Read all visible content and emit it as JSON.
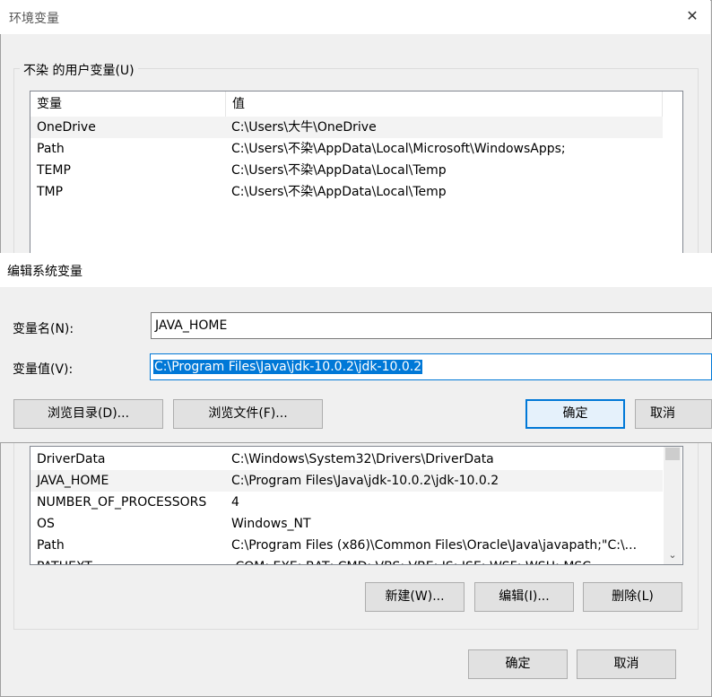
{
  "env": {
    "title": "环境变量",
    "close_glyph": "✕",
    "user_group_label": "不染 的用户变量(U)",
    "columns": {
      "var": "变量",
      "val": "值"
    },
    "user_vars": [
      {
        "name": "OneDrive",
        "value": "C:\\Users\\大牛\\OneDrive"
      },
      {
        "name": "Path",
        "value": "C:\\Users\\不染\\AppData\\Local\\Microsoft\\WindowsApps;"
      },
      {
        "name": "TEMP",
        "value": "C:\\Users\\不染\\AppData\\Local\\Temp"
      },
      {
        "name": "TMP",
        "value": "C:\\Users\\不染\\AppData\\Local\\Temp"
      }
    ],
    "system_vars": [
      {
        "name": "DriverData",
        "value": "C:\\Windows\\System32\\Drivers\\DriverData"
      },
      {
        "name": "JAVA_HOME",
        "value": "C:\\Program Files\\Java\\jdk-10.0.2\\jdk-10.0.2"
      },
      {
        "name": "NUMBER_OF_PROCESSORS",
        "value": "4"
      },
      {
        "name": "OS",
        "value": "Windows_NT"
      },
      {
        "name": "Path",
        "value": "C:\\Program Files (x86)\\Common Files\\Oracle\\Java\\javapath;\"C:\\..."
      },
      {
        "name": "PATHEXT",
        "value": ".COM;.EXE;.BAT;.CMD;.VBS;.VBE;.JS;.JSE;.WSF;.WSH;.MSC"
      }
    ],
    "scroll_down_glyph": "⌄",
    "sys_buttons": {
      "new": "新建(W)...",
      "edit": "编辑(I)...",
      "delete": "删除(L)"
    },
    "ok": "确定",
    "cancel": "取消"
  },
  "edit": {
    "title": "编辑系统变量",
    "name_label": "变量名(N):",
    "value_label": "变量值(V):",
    "name_value": "JAVA_HOME",
    "value_value": "C:\\Program Files\\Java\\jdk-10.0.2\\jdk-10.0.2",
    "browse_dir": "浏览目录(D)...",
    "browse_file": "浏览文件(F)...",
    "ok": "确定",
    "cancel": "取消"
  }
}
